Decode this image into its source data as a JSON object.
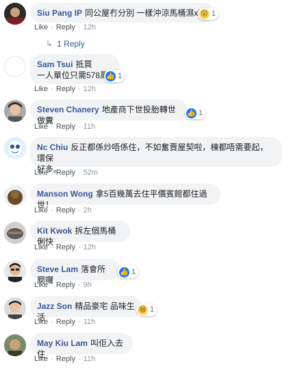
{
  "comments": [
    {
      "author": "Siu Pang IP",
      "text": "同公屋冇分別 一樣沖涼馬桶濕x晒",
      "reaction": {
        "type": "wow",
        "count": "1"
      },
      "time": "12h",
      "replies": "1 Reply",
      "like": "Like",
      "reply": "Reply"
    },
    {
      "author": "Sam Tsui",
      "text": "抵買",
      "text2": "一人單位只需578萬",
      "reaction": {
        "type": "like",
        "count": "1"
      },
      "time": "12h",
      "like": "Like",
      "reply": "Reply"
    },
    {
      "author": "Steven Chanery",
      "text": "地產商下世投胎轉世做糞",
      "reaction": {
        "type": "like",
        "count": "1"
      },
      "time": "11h",
      "like": "Like",
      "reply": "Reply"
    },
    {
      "author": "Nc Chiu",
      "text": "反正都係炒唔係住，不如奮賣屋契啦，棟都唔需要起，環保",
      "text2": "好多。",
      "time": "52m",
      "like": "Like",
      "reply": "Reply"
    },
    {
      "author": "Manson Wong",
      "text": "拿5百幾萬去住平價賓館都住過世！",
      "time": "2h",
      "like": "Like",
      "reply": "Reply"
    },
    {
      "author": "Kit Kwok",
      "text": "拆左個馬桶俐快",
      "time": "12h",
      "like": "Like",
      "reply": "Reply"
    },
    {
      "author": "Steve Lam",
      "text": "落會所屙囉",
      "reaction": {
        "type": "like",
        "count": "1"
      },
      "time": "9h",
      "like": "Like",
      "reply": "Reply"
    },
    {
      "author": "Jazz Son",
      "text": "精品豪宅 品味生活",
      "reaction": {
        "type": "haha",
        "count": "1"
      },
      "time": "11h",
      "like": "Like",
      "reply": "Reply"
    },
    {
      "author": "May Kiu Lam",
      "text": "叫佢入去住",
      "time": "11h",
      "like": "Like",
      "reply": "Reply"
    }
  ],
  "colors": {
    "author": "#385898",
    "bubble": "#f2f3f5",
    "meta": "#90949c",
    "like_blue": "#2078f4"
  },
  "icons": {
    "like": "thumbs-up-icon",
    "wow": "wow-face-icon",
    "haha": "haha-face-icon",
    "reply_arrow": "reply-arrow-icon"
  }
}
